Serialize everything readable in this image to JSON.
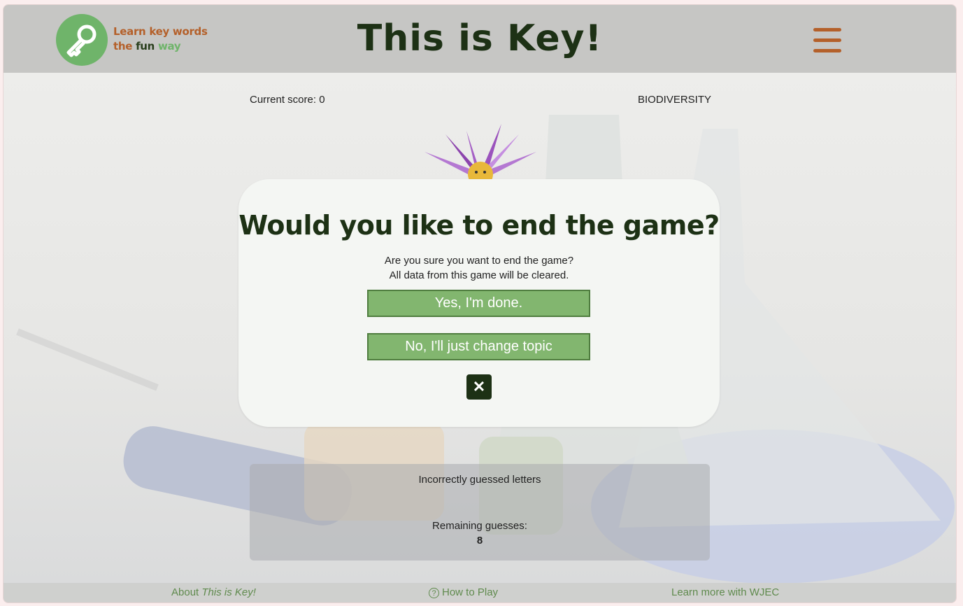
{
  "header": {
    "logo_line1": "Learn key words",
    "logo_the": "the",
    "logo_fun": "fun",
    "logo_way": "way",
    "title": "This is Key!",
    "menu_icon": "hamburger-icon"
  },
  "game": {
    "score_text": "Current score: 0",
    "topic": "BIODIVERSITY",
    "incorrect_label": "Incorrectly guessed letters",
    "remaining_label": "Remaining guesses:",
    "remaining_count": "8"
  },
  "modal": {
    "title": "Would you like to end the game?",
    "line1": "Are you sure you want to end the game?",
    "line2": "All data from this game will be cleared.",
    "yes_label": "Yes, I'm done.",
    "no_label": "No, I'll just change topic",
    "close_icon": "close-icon"
  },
  "footer": {
    "about_prefix": "About ",
    "about_name": "This is Key!",
    "howto": "How to Play",
    "learn_more": "Learn more with WJEC"
  },
  "colors": {
    "brand_green": "#6fb46a",
    "brand_orange": "#b4602a",
    "dark_green": "#1d3115",
    "button_green": "#82b66f"
  }
}
